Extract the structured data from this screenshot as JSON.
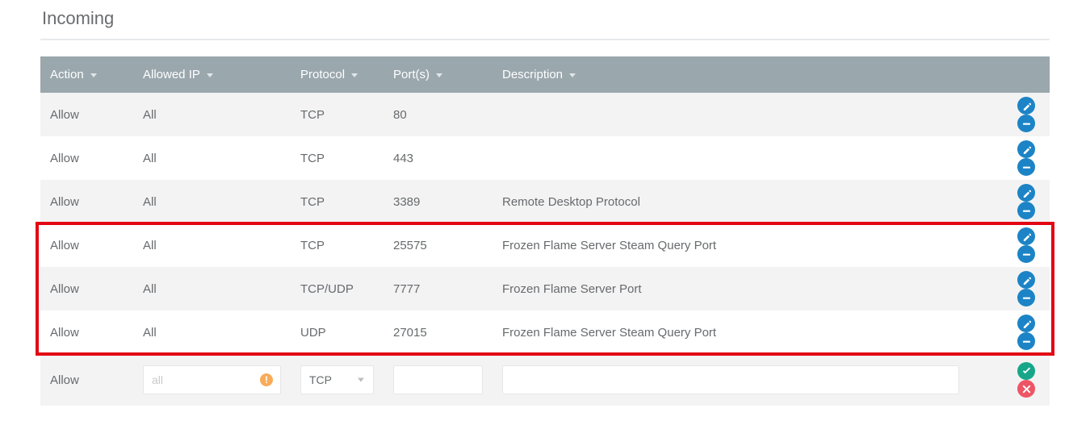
{
  "section_title": "Incoming",
  "columns": {
    "action": "Action",
    "allowed_ip": "Allowed IP",
    "protocol": "Protocol",
    "ports": "Port(s)",
    "description": "Description"
  },
  "rows": [
    {
      "action": "Allow",
      "allowed_ip": "All",
      "protocol": "TCP",
      "ports": "80",
      "description": ""
    },
    {
      "action": "Allow",
      "allowed_ip": "All",
      "protocol": "TCP",
      "ports": "443",
      "description": ""
    },
    {
      "action": "Allow",
      "allowed_ip": "All",
      "protocol": "TCP",
      "ports": "3389",
      "description": "Remote Desktop Protocol"
    },
    {
      "action": "Allow",
      "allowed_ip": "All",
      "protocol": "TCP",
      "ports": "25575",
      "description": "Frozen Flame Server Steam Query Port"
    },
    {
      "action": "Allow",
      "allowed_ip": "All",
      "protocol": "TCP/UDP",
      "ports": "7777",
      "description": "Frozen Flame Server Port"
    },
    {
      "action": "Allow",
      "allowed_ip": "All",
      "protocol": "UDP",
      "ports": "27015",
      "description": "Frozen Flame Server Steam Query Port"
    }
  ],
  "add_row": {
    "action_label": "Allow",
    "allowed_ip_placeholder": "all",
    "allowed_ip_value": "",
    "protocol_selected": "TCP",
    "ports_value": "",
    "description_value": ""
  },
  "icons": {
    "edit": "edit-icon",
    "remove": "minus-icon",
    "confirm": "check-icon",
    "cancel": "times-icon",
    "warn": "!"
  },
  "highlight": {
    "start_index": 3,
    "end_index": 5
  }
}
